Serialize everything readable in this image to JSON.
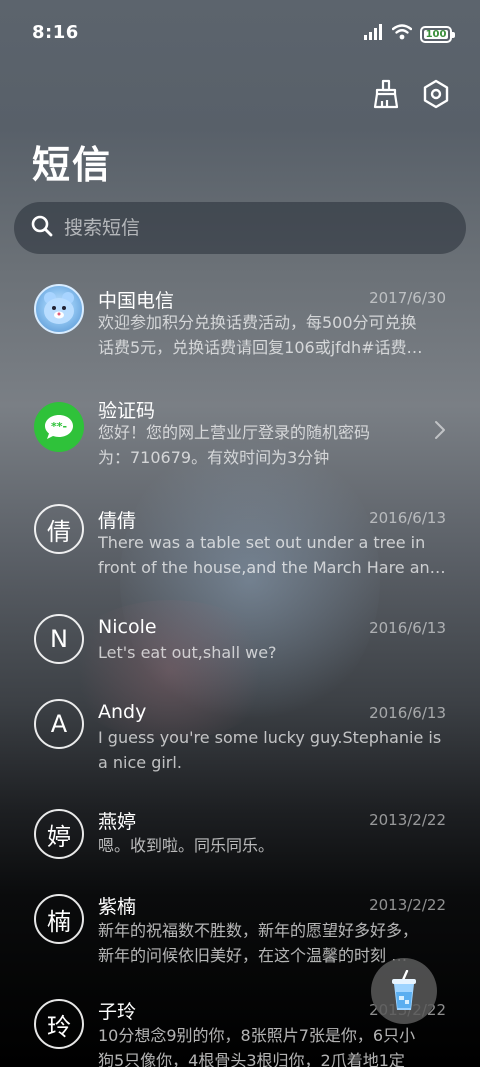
{
  "status_bar": {
    "time": "8:16",
    "battery": "100",
    "icons": [
      "signal-icon",
      "wifi-icon",
      "battery-icon"
    ]
  },
  "header": {
    "title": "短信",
    "actions": [
      "broom-icon",
      "settings-hex-icon"
    ]
  },
  "search": {
    "placeholder": "搜索短信"
  },
  "conversations": [
    {
      "name": "中国电信",
      "date": "2017/6/30",
      "line1": "欢迎参加积分兑换话费活动，每500分可兑换",
      "line2": "话费5元，兑换话费请回复106或jfdh#话费…",
      "avatar_type": "photo"
    },
    {
      "name": "验证码",
      "date": "",
      "line1": "您好！您的网上营业厅登录的随机密码",
      "line2": "为：710679。有效时间为3分钟",
      "avatar_type": "sms-bubble-icon"
    },
    {
      "name": "倩倩",
      "date": "2016/6/13",
      "line1": "There was a table set out under a tree in",
      "line2": "front of the house,and the March Hare an…",
      "avatar_letter": "倩"
    },
    {
      "name": "Nicole",
      "date": "2016/6/13",
      "line1": "Let's eat out,shall we?",
      "line2": "",
      "avatar_letter": "N"
    },
    {
      "name": "Andy",
      "date": "2016/6/13",
      "line1": "I guess you're some lucky guy.Stephanie is",
      "line2": "a nice girl.",
      "avatar_letter": "A"
    },
    {
      "name": "燕婷",
      "date": "2013/2/22",
      "line1": "嗯。收到啦。同乐同乐。",
      "line2": "",
      "avatar_letter": "婷"
    },
    {
      "name": "紫楠",
      "date": "2013/2/22",
      "line1": "新年的祝福数不胜数，新年的愿望好多好多，",
      "line2": "新年的问候依旧美好，在这个温馨的时刻 …",
      "avatar_letter": "楠"
    },
    {
      "name": "子玲",
      "date": "2013/2/22",
      "line1": "10分想念9别的你，8张照片7张是你，6只小",
      "line2": "狗5只像你，4根骨头3根归你，2爪着地1定",
      "avatar_letter": "玲"
    }
  ],
  "fab": {
    "icon": "drink-cup-icon"
  },
  "colors": {
    "green_avatar": "#2fc23a",
    "background_top": "#5c646d",
    "background_bottom": "#000000"
  }
}
